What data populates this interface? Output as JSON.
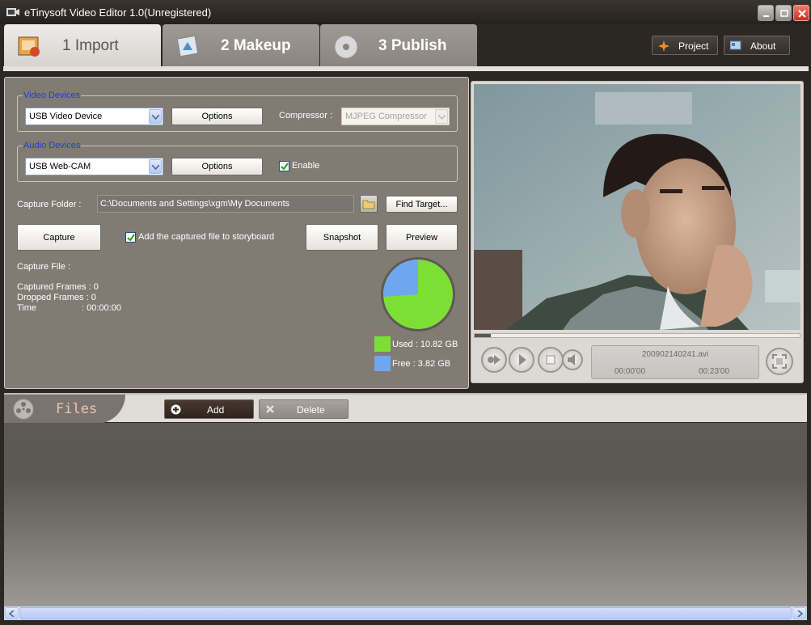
{
  "window": {
    "title": "eTinysoft Video Editor 1.0(Unregistered)"
  },
  "tabs": [
    {
      "label": "1 Import",
      "icon": "import-icon",
      "active": true
    },
    {
      "label": "2 Makeup",
      "icon": "makeup-icon",
      "active": false
    },
    {
      "label": "3 Publish",
      "icon": "disc-icon",
      "active": false
    }
  ],
  "toolbar": {
    "project_label": "Project",
    "about_label": "About"
  },
  "video_devices": {
    "group_label": "Video Devices",
    "device": "USB Video Device",
    "options_label": "Options",
    "compressor_label": "Compressor :",
    "compressor": "MJPEG Compressor"
  },
  "audio_devices": {
    "group_label": "Audio Devices",
    "device": "USB Web-CAM",
    "options_label": "Options",
    "enable_label": "Enable",
    "enabled": true
  },
  "capture": {
    "folder_label": "Capture Folder :",
    "folder_path": "C:\\Documents and Settings\\xgm\\My Documents",
    "find_target_label": "Find Target...",
    "capture_label": "Capture",
    "add_to_storyboard_label": "Add the captured file to storyboard",
    "add_to_storyboard": true,
    "snapshot_label": "Snapshot",
    "preview_label": "Preview",
    "file_label": "Capture File :",
    "captured_frames": "Captured Frames : 0",
    "dropped_frames": "Dropped  Frames : 0",
    "time_label": "Time",
    "time_value": ": 00:00:00"
  },
  "disk": {
    "used_label": "Used :  10.82 GB",
    "free_label": "Free :  3.82 GB",
    "used_gb": 10.82,
    "free_gb": 3.82,
    "used_color": "#7ddf36",
    "free_color": "#6ea7ef"
  },
  "player": {
    "filename": "200902140241.avi",
    "current_time": "00:00'00",
    "total_time": "00:23'00",
    "progress": 0.05
  },
  "files": {
    "title": "Files",
    "add_label": "Add",
    "delete_label": "Delete"
  }
}
